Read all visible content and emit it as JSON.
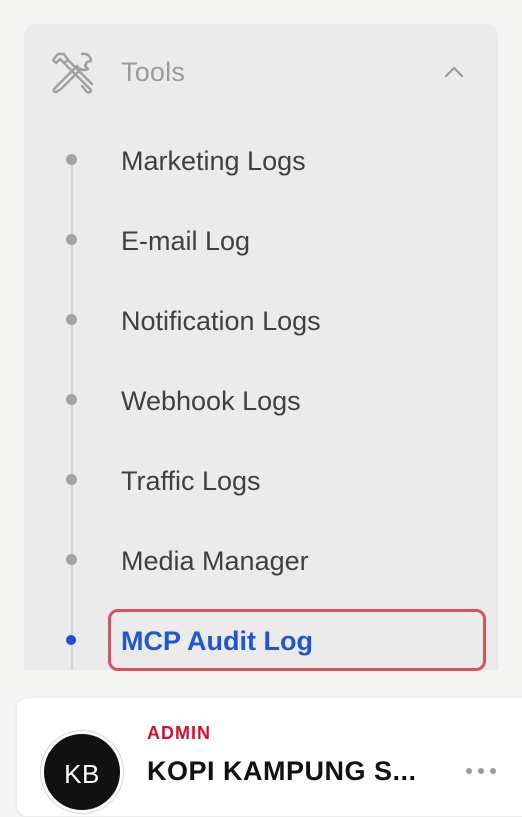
{
  "tools_section": {
    "label": "Tools",
    "icon": "wrench-screwdriver-icon",
    "expanded": true,
    "items": [
      {
        "label": "Marketing Logs",
        "active": false
      },
      {
        "label": "E-mail Log",
        "active": false
      },
      {
        "label": "Notification Logs",
        "active": false
      },
      {
        "label": "Webhook Logs",
        "active": false
      },
      {
        "label": "Traffic Logs",
        "active": false
      },
      {
        "label": "Media Manager",
        "active": false
      },
      {
        "label": "MCP Audit Log",
        "active": true
      }
    ]
  },
  "user_card": {
    "avatar_initials": "KB",
    "role": "ADMIN",
    "name": "KOPI KAMPUNG S..."
  },
  "colors": {
    "active": "#2056d4",
    "role": "#d4102a",
    "highlight": "#d9505f"
  }
}
